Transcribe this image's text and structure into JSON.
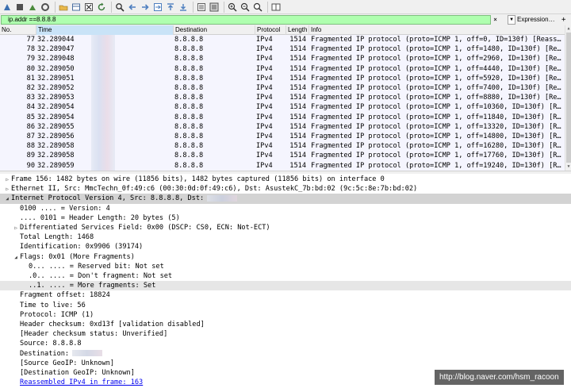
{
  "toolbar": {
    "icons": [
      "shark-fin-start-icon",
      "stop-square-icon",
      "restart-icon",
      "capture-options-icon",
      "open-folder-icon",
      "table-icon",
      "close-file-icon",
      "reload-icon",
      "find-icon",
      "back-arrow-icon",
      "forward-arrow-icon",
      "go-to-packet-icon",
      "first-packet-icon",
      "last-packet-icon",
      "auto-scroll-icon",
      "colorize-icon",
      "zoom-in-icon",
      "zoom-out-icon",
      "zoom-normal-icon",
      "resize-columns-icon"
    ]
  },
  "filter": {
    "value": "ip.addr ==8.8.8.8",
    "clear_icon": "×",
    "dropdown_icon": "▼",
    "expression_label": "Expression…",
    "plus_label": "+"
  },
  "packet_list": {
    "columns": [
      "No.",
      "Time",
      "Destination",
      "Protocol",
      "Length",
      "Info"
    ],
    "rows": [
      {
        "no": "77",
        "time": "32.289044",
        "dst": "8.8.8.8",
        "proto": "IPv4",
        "len": "1514",
        "info": "Fragmented IP protocol (proto=ICMP 1, off=0, ID=130f) [Reass…"
      },
      {
        "no": "78",
        "time": "32.289047",
        "dst": "8.8.8.8",
        "proto": "IPv4",
        "len": "1514",
        "info": "Fragmented IP protocol (proto=ICMP 1, off=1480, ID=130f) [Re…"
      },
      {
        "no": "79",
        "time": "32.289048",
        "dst": "8.8.8.8",
        "proto": "IPv4",
        "len": "1514",
        "info": "Fragmented IP protocol (proto=ICMP 1, off=2960, ID=130f) [Re…"
      },
      {
        "no": "80",
        "time": "32.289050",
        "dst": "8.8.8.8",
        "proto": "IPv4",
        "len": "1514",
        "info": "Fragmented IP protocol (proto=ICMP 1, off=4440, ID=130f) [Re…"
      },
      {
        "no": "81",
        "time": "32.289051",
        "dst": "8.8.8.8",
        "proto": "IPv4",
        "len": "1514",
        "info": "Fragmented IP protocol (proto=ICMP 1, off=5920, ID=130f) [Re…"
      },
      {
        "no": "82",
        "time": "32.289052",
        "dst": "8.8.8.8",
        "proto": "IPv4",
        "len": "1514",
        "info": "Fragmented IP protocol (proto=ICMP 1, off=7400, ID=130f) [Re…"
      },
      {
        "no": "83",
        "time": "32.289053",
        "dst": "8.8.8.8",
        "proto": "IPv4",
        "len": "1514",
        "info": "Fragmented IP protocol (proto=ICMP 1, off=8880, ID=130f) [Re…"
      },
      {
        "no": "84",
        "time": "32.289054",
        "dst": "8.8.8.8",
        "proto": "IPv4",
        "len": "1514",
        "info": "Fragmented IP protocol (proto=ICMP 1, off=10360, ID=130f) [R…"
      },
      {
        "no": "85",
        "time": "32.289054",
        "dst": "8.8.8.8",
        "proto": "IPv4",
        "len": "1514",
        "info": "Fragmented IP protocol (proto=ICMP 1, off=11840, ID=130f) [R…"
      },
      {
        "no": "86",
        "time": "32.289055",
        "dst": "8.8.8.8",
        "proto": "IPv4",
        "len": "1514",
        "info": "Fragmented IP protocol (proto=ICMP 1, off=13320, ID=130f) [R…"
      },
      {
        "no": "87",
        "time": "32.289056",
        "dst": "8.8.8.8",
        "proto": "IPv4",
        "len": "1514",
        "info": "Fragmented IP protocol (proto=ICMP 1, off=14800, ID=130f) [R…"
      },
      {
        "no": "88",
        "time": "32.289058",
        "dst": "8.8.8.8",
        "proto": "IPv4",
        "len": "1514",
        "info": "Fragmented IP protocol (proto=ICMP 1, off=16280, ID=130f) [R…"
      },
      {
        "no": "89",
        "time": "32.289058",
        "dst": "8.8.8.8",
        "proto": "IPv4",
        "len": "1514",
        "info": "Fragmented IP protocol (proto=ICMP 1, off=17760, ID=130f) [R…"
      },
      {
        "no": "90",
        "time": "32.289059",
        "dst": "8.8.8.8",
        "proto": "IPv4",
        "len": "1514",
        "info": "Fragmented IP protocol (proto=ICMP 1, off=19240, ID=130f) [R…"
      }
    ]
  },
  "details": {
    "lines": [
      {
        "indent": 0,
        "expander": "▷",
        "text": "Frame 156: 1482 bytes on wire (11856 bits), 1482 bytes captured (11856 bits) on interface 0"
      },
      {
        "indent": 0,
        "expander": "▷",
        "text": "Ethernet II, Src: MmcTechn_0f:49:c6 (00:30:0d:0f:49:c6), Dst: AsustekC_7b:bd:02 (9c:5c:8e:7b:bd:02)"
      },
      {
        "indent": 0,
        "expander": "◢",
        "text": "Internet Protocol Version 4, Src: 8.8.8.8, Dst:",
        "redacted": true,
        "highlight": true
      },
      {
        "indent": 1,
        "expander": "",
        "text": "0100 .... = Version: 4"
      },
      {
        "indent": 1,
        "expander": "",
        "text": ".... 0101 = Header Length: 20 bytes (5)"
      },
      {
        "indent": 1,
        "expander": "▷",
        "text": "Differentiated Services Field: 0x00 (DSCP: CS0, ECN: Not-ECT)"
      },
      {
        "indent": 1,
        "expander": "",
        "text": "Total Length: 1468"
      },
      {
        "indent": 1,
        "expander": "",
        "text": "Identification: 0x9906 (39174)"
      },
      {
        "indent": 1,
        "expander": "◢",
        "text": "Flags: 0x01 (More Fragments)"
      },
      {
        "indent": 2,
        "expander": "",
        "text": "0... .... = Reserved bit: Not set"
      },
      {
        "indent": 2,
        "expander": "",
        "text": ".0.. .... = Don't fragment: Not set"
      },
      {
        "indent": 2,
        "expander": "",
        "text": "..1. .... = More fragments: Set",
        "selected": true
      },
      {
        "indent": 1,
        "expander": "",
        "text": "Fragment offset: 18824"
      },
      {
        "indent": 1,
        "expander": "",
        "text": "Time to live: 56"
      },
      {
        "indent": 1,
        "expander": "",
        "text": "Protocol: ICMP (1)"
      },
      {
        "indent": 1,
        "expander": "",
        "text": "Header checksum: 0xd13f [validation disabled]"
      },
      {
        "indent": 1,
        "expander": "",
        "text": "[Header checksum status: Unverified]"
      },
      {
        "indent": 1,
        "expander": "",
        "text": "Source: 8.8.8.8"
      },
      {
        "indent": 1,
        "expander": "",
        "text": "Destination:",
        "redacted": true
      },
      {
        "indent": 1,
        "expander": "",
        "text": "[Source GeoIP: Unknown]"
      },
      {
        "indent": 1,
        "expander": "",
        "text": "[Destination GeoIP: Unknown]"
      },
      {
        "indent": 1,
        "expander": "",
        "text": "Reassembled IPv4 in frame: 163",
        "link": true
      }
    ]
  },
  "watermark": "http://blog.naver.com/hsm_racoon",
  "colors": {
    "filter_ok": "#afffaf",
    "row_bg": "#f5f5fe",
    "time_header": "#c9e3f7",
    "link": "#0000ee"
  }
}
